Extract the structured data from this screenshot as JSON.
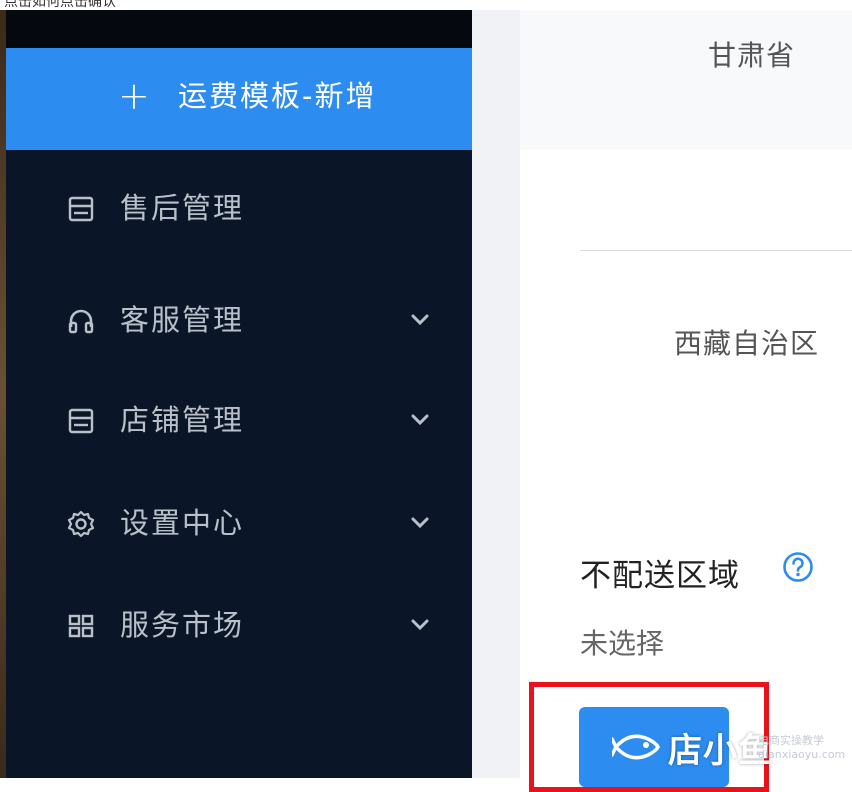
{
  "top_strip": {
    "text": "点击如何点击确认"
  },
  "sidebar": {
    "active_item": {
      "icon": "plus-icon",
      "label": "运费模板-新增"
    },
    "items": [
      {
        "icon": "document-icon",
        "label": "售后管理",
        "has_chevron": false
      },
      {
        "icon": "headphones-icon",
        "label": "客服管理",
        "has_chevron": true
      },
      {
        "icon": "document-icon",
        "label": "店铺管理",
        "has_chevron": true
      },
      {
        "icon": "gear-icon",
        "label": "设置中心",
        "has_chevron": true
      },
      {
        "icon": "grid-icon",
        "label": "服务市场",
        "has_chevron": true
      }
    ]
  },
  "panel": {
    "province_1": "甘肃省",
    "province_2": "西藏自治区",
    "no_delivery_title": "不配送区域",
    "no_delivery_value": "未选择"
  },
  "watermark": {
    "brand": "店小鱼",
    "small_1": "电商实操教学",
    "small_2": "dianxiaoyu.com"
  },
  "colors": {
    "sidebar_bg": "#0a1628",
    "accent": "#2d8cf0",
    "highlight_border": "#e8121c"
  }
}
